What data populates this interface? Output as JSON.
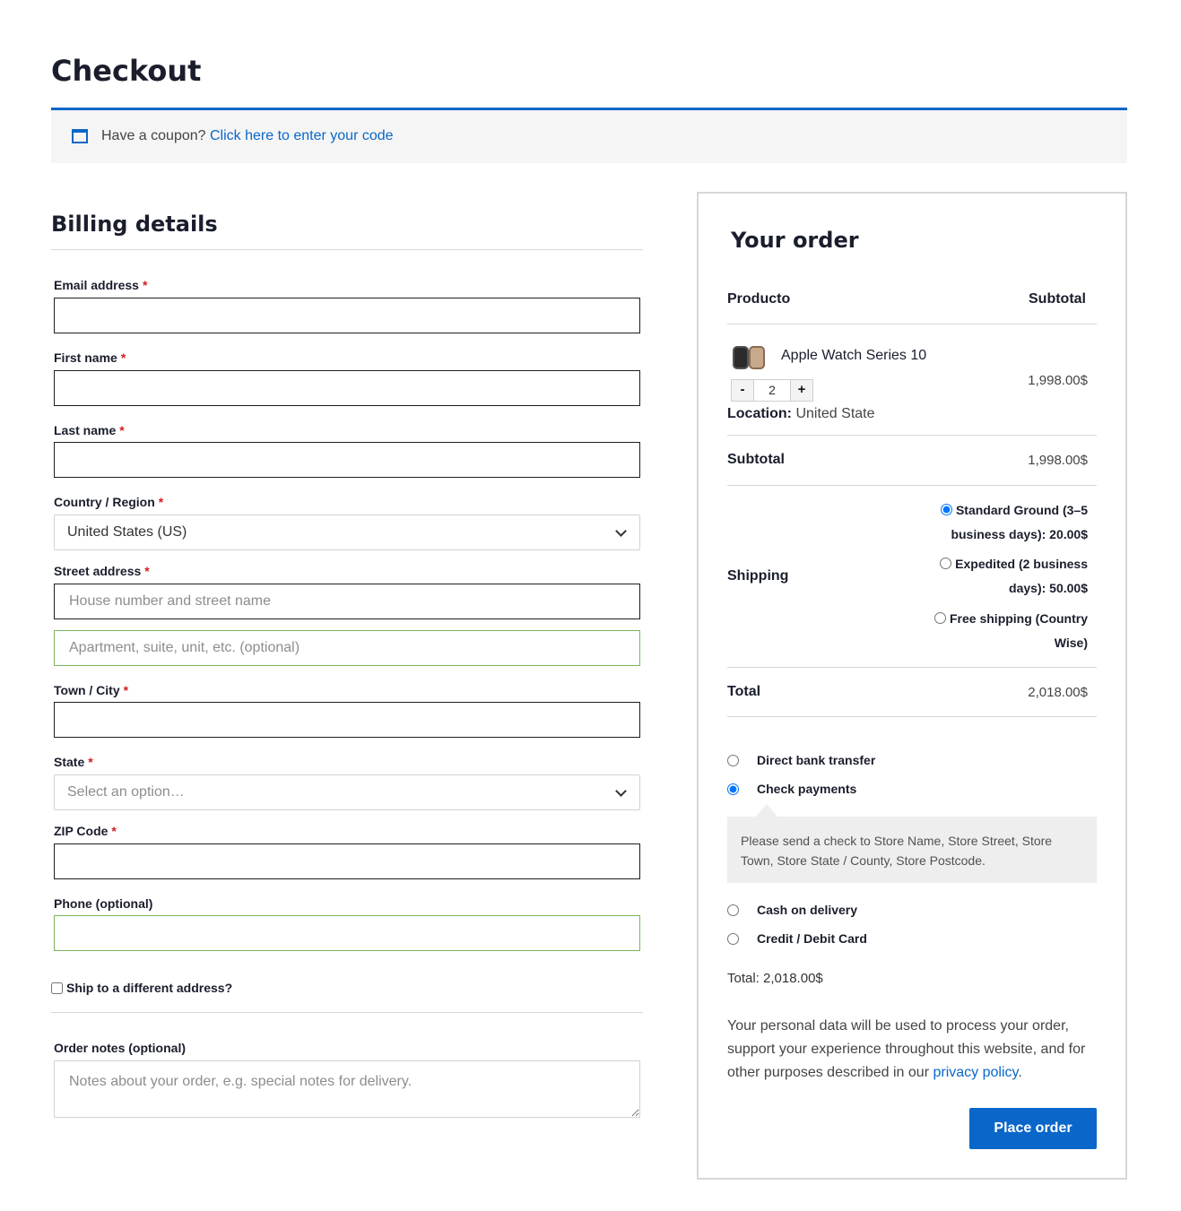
{
  "page": {
    "title": "Checkout"
  },
  "coupon": {
    "prompt": "Have a coupon?",
    "link": "Click here to enter your code"
  },
  "billing": {
    "title": "Billing details",
    "required_mark": "*",
    "email_label": "Email address",
    "first_name_label": "First name",
    "last_name_label": "Last name",
    "country_label": "Country / Region",
    "country_value": "United States (US)",
    "street_label": "Street address",
    "street_placeholder": "House number and street name",
    "apt_placeholder": "Apartment, suite, unit, etc. (optional)",
    "city_label": "Town / City",
    "state_label": "State",
    "state_placeholder": "Select an option…",
    "zip_label": "ZIP Code",
    "phone_label": "Phone (optional)",
    "ship_different": "Ship to a different address?",
    "notes_label": "Order notes (optional)",
    "notes_placeholder": "Notes about your order, e.g. special notes for delivery."
  },
  "order": {
    "title": "Your order",
    "col_product": "Producto",
    "col_subtotal": "Subtotal",
    "item": {
      "name": "Apple Watch Series 10",
      "qty_minus": "-",
      "qty": "2",
      "qty_plus": "+",
      "location_label": "Location:",
      "location_value": "United State",
      "price": "1,998.00$"
    },
    "subtotal_label": "Subtotal",
    "subtotal_value": "1,998.00$",
    "shipping_label": "Shipping",
    "shipping_options": [
      {
        "line1": "Standard Ground (3–5",
        "line2": "business days):",
        "price": "20.00$",
        "selected": true
      },
      {
        "line1": "Expedited (2 business",
        "line2": "days):",
        "price": "50.00$",
        "selected": false
      },
      {
        "line1": "Free shipping (Country",
        "line2": "Wise)",
        "price": "",
        "selected": false
      }
    ],
    "total_label": "Total",
    "total_value": "2,018.00$",
    "payment_methods": [
      {
        "label": "Direct bank transfer",
        "selected": false
      },
      {
        "label": "Check payments",
        "selected": true
      },
      {
        "label": "Cash on delivery",
        "selected": false
      },
      {
        "label": "Credit / Debit Card",
        "selected": false
      }
    ],
    "check_description": "Please send a check to Store Name, Store Street, Store Town, Store State / County, Store Postcode.",
    "total_line": "Total: 2,018.00$",
    "privacy_text": "Your personal data will be used to process your order, support your experience throughout this website, and for other purposes described in our",
    "privacy_link": "privacy policy",
    "privacy_end": ".",
    "place_order": "Place order"
  },
  "colors": {
    "accent": "#0a67c9",
    "required": "#d21d1d",
    "valid_border": "#7ab55c"
  }
}
